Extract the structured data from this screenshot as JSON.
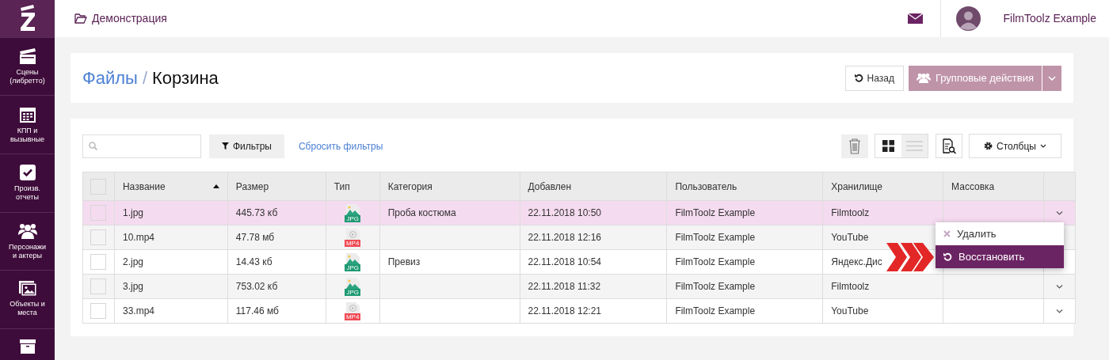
{
  "sidebar": {
    "items": [
      {
        "label": "Сцены (либретто)"
      },
      {
        "label": "КПП и вызывные"
      },
      {
        "label": "Произв. отчеты"
      },
      {
        "label": "Персонажи и актеры"
      },
      {
        "label": "Объекты и места"
      }
    ]
  },
  "topbar": {
    "project": "Демонстрация",
    "user": "FilmToolz Example"
  },
  "header": {
    "breadcrumb": "Файлы",
    "separator": "/",
    "title": "Корзина",
    "back_button": "Назад",
    "group_button": "Групповые действия",
    "group_disabled": true
  },
  "toolbar": {
    "filters_button": "Фильтры",
    "reset_link": "Сбросить фильтры",
    "view_modes": [
      {
        "kind": "grid",
        "selected": false
      },
      {
        "kind": "list",
        "selected": true
      }
    ],
    "columns_button": "Столбцы"
  },
  "table": {
    "select_all_checked": false,
    "columns": [
      "Название",
      "Размер",
      "Тип",
      "Категория",
      "Добавлен",
      "Пользователь",
      "Хранилище",
      "Массовка"
    ],
    "rows": [
      {
        "name": "1.jpg",
        "size": "445.73 кб",
        "type": "JPG",
        "category": "Проба костюма",
        "added": "22.11.2018 10:50",
        "user": "FilmToolz Example",
        "storage": "Filmtoolz",
        "checked": false,
        "selected": true,
        "chevron": true
      },
      {
        "name": "10.mp4",
        "size": "47.78 мб",
        "type": "MP4",
        "added": "22.11.2018 12:16",
        "user": "FilmToolz Example",
        "storage": "YouTube",
        "checked": false,
        "selected": false,
        "chevron": false
      },
      {
        "name": "2.jpg",
        "size": "14.43 кб",
        "type": "JPG",
        "category": "Превиз",
        "added": "22.11.2018 10:54",
        "user": "FilmToolz Example",
        "storage": "Яндекс.Дис",
        "checked": false,
        "selected": false,
        "chevron": false
      },
      {
        "name": "3.jpg",
        "size": "753.02 кб",
        "type": "JPG",
        "added": "22.11.2018 11:32",
        "user": "FilmToolz Example",
        "storage": "Filmtoolz",
        "checked": false,
        "selected": false,
        "chevron": true
      },
      {
        "name": "33.mp4",
        "size": "117.46 мб",
        "type": "MP4",
        "added": "22.11.2018 12:21",
        "user": "FilmToolz Example",
        "storage": "YouTube",
        "checked": false,
        "selected": false,
        "chevron": true
      }
    ]
  },
  "context_menu": {
    "items": [
      {
        "label": "Удалить",
        "kind": "delete",
        "selected": false
      },
      {
        "label": "Восстановить",
        "kind": "restore",
        "selected": true
      }
    ]
  }
}
